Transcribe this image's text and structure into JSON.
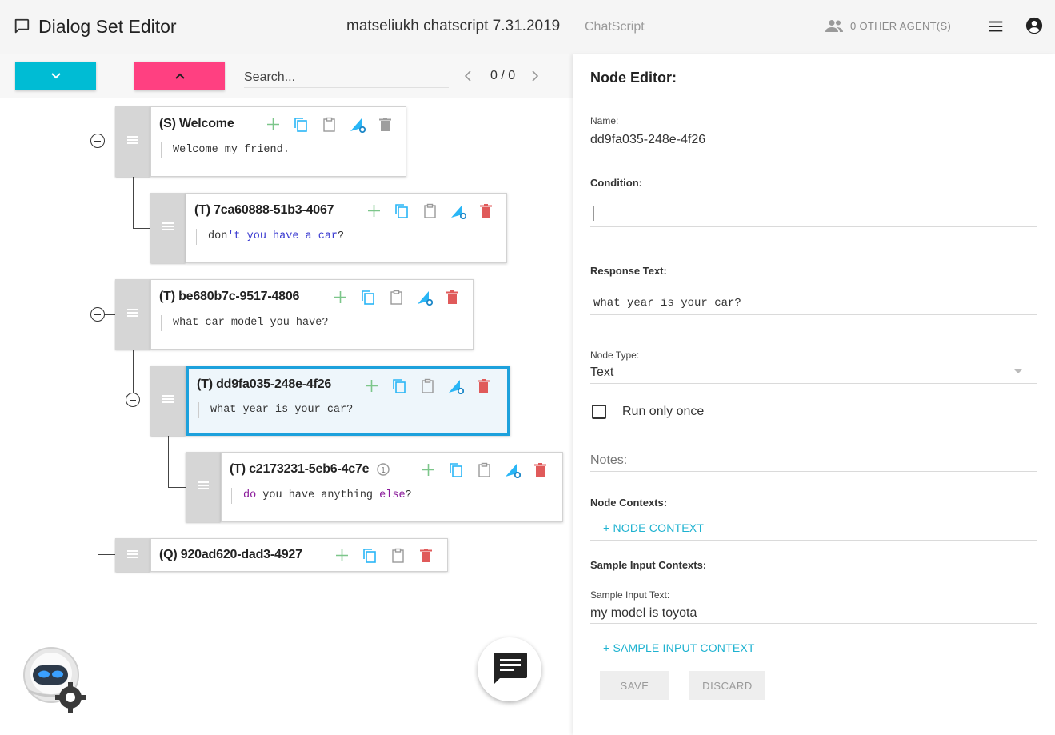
{
  "header": {
    "app_title": "Dialog Set Editor",
    "project_title": "matseliukh chatscript 7.31.2019",
    "project_engine": "ChatScript",
    "agents_label": "0 OTHER AGENT(S)"
  },
  "toolbar": {
    "search_placeholder": "Search...",
    "search_count": "0 / 0"
  },
  "tree": {
    "nodes": [
      {
        "title": "(S) Welcome",
        "text": "Welcome my friend."
      },
      {
        "title": "(T) 7ca60888-51b3-4067",
        "text_parts": [
          "don",
          "'t you have a car",
          "?"
        ]
      },
      {
        "title": "(T) be680b7c-9517-4806",
        "text": "what car model you have?"
      },
      {
        "title": "(T) dd9fa035-248e-4f26",
        "text": "what year is your car?",
        "selected": true
      },
      {
        "title": "(T) c2173231-5eb6-4c7e",
        "text_parts": [
          "do",
          " you have anything ",
          "else",
          "?"
        ]
      },
      {
        "title": "(Q) 920ad620-dad3-4927"
      }
    ]
  },
  "editor": {
    "title": "Node Editor:",
    "name_label": "Name:",
    "name_value": "dd9fa035-248e-4f26",
    "condition_label": "Condition:",
    "condition_value": "",
    "response_label": "Response Text:",
    "response_value": "what year is your car?",
    "node_type_label": "Node Type:",
    "node_type_value": "Text",
    "run_once_label": "Run only once",
    "run_once_checked": false,
    "notes_placeholder": "Notes:",
    "node_contexts_label": "Node Contexts:",
    "add_node_context": "+ NODE CONTEXT",
    "sample_inputs_label": "Sample Input Contexts:",
    "sample_input_text_label": "Sample Input Text:",
    "sample_input_text_value": "my model is toyota",
    "add_sample_input": "+ SAMPLE INPUT CONTEXT",
    "save_label": "SAVE",
    "discard_label": "DISCARD"
  },
  "colors": {
    "accent_cyan": "#00bcd4",
    "accent_pink": "#ff4081",
    "selected_border": "#1da1dc",
    "add_icon": "#7cc68a",
    "copy_icon": "#29b6f6",
    "delete_icon": "#e05a5a"
  },
  "icons": [
    "add-icon",
    "copy-icon",
    "paste-icon",
    "node-settings-icon",
    "delete-icon",
    "chevron-down-icon",
    "chevron-up-icon",
    "chevron-left-icon",
    "chevron-right-icon",
    "chat-icon",
    "menu-icon",
    "account-icon",
    "people-icon"
  ]
}
